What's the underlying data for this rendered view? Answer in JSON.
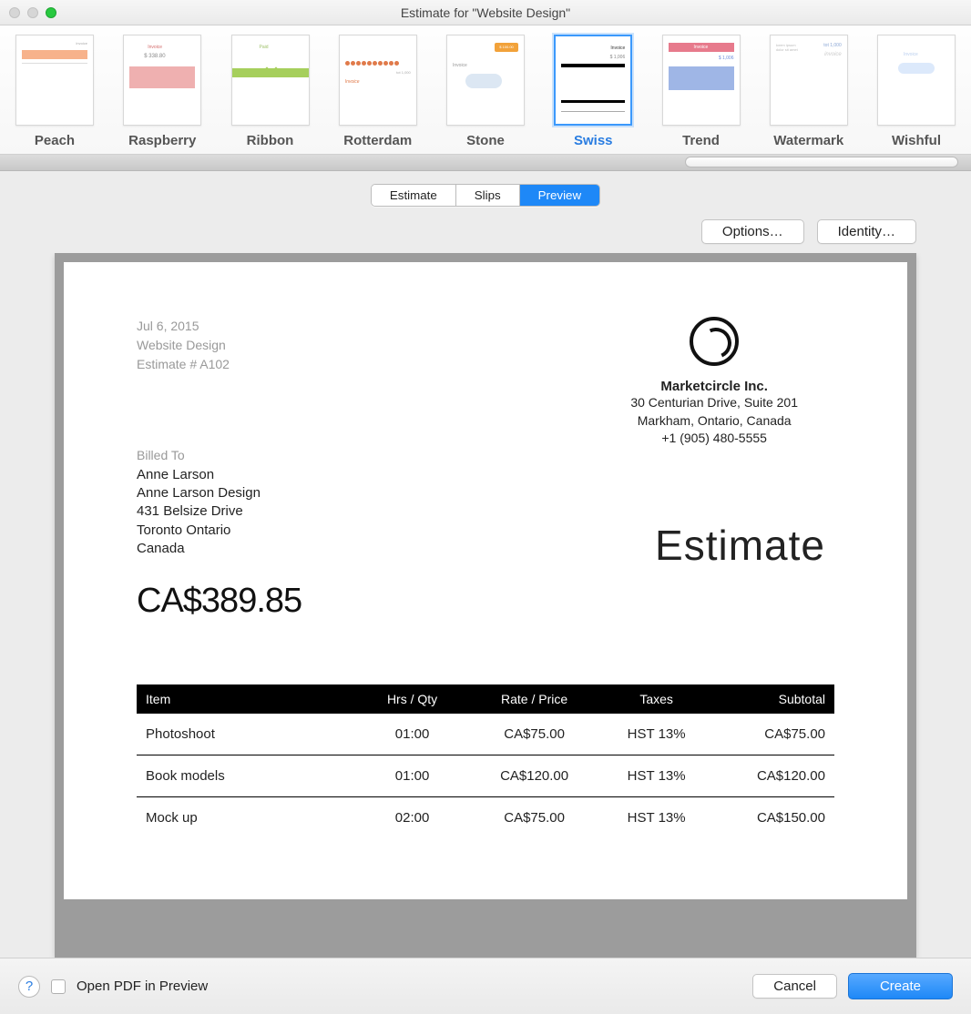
{
  "window": {
    "title": "Estimate for \"Website Design\""
  },
  "templates": [
    {
      "id": "peach",
      "label": "Peach"
    },
    {
      "id": "raspberry",
      "label": "Raspberry"
    },
    {
      "id": "ribbon",
      "label": "Ribbon"
    },
    {
      "id": "rotterdam",
      "label": "Rotterdam"
    },
    {
      "id": "stone",
      "label": "Stone"
    },
    {
      "id": "swiss",
      "label": "Swiss",
      "selected": true
    },
    {
      "id": "trend",
      "label": "Trend"
    },
    {
      "id": "watermark",
      "label": "Watermark"
    },
    {
      "id": "wishful",
      "label": "Wishful"
    }
  ],
  "tabs": {
    "estimate": "Estimate",
    "slips": "Slips",
    "preview": "Preview",
    "active": "preview"
  },
  "buttons": {
    "options": "Options…",
    "identity": "Identity…",
    "cancel": "Cancel",
    "create": "Create",
    "open_pdf": "Open PDF in Preview"
  },
  "preview": {
    "date": "Jul 6, 2015",
    "project": "Website Design",
    "estimate_no": "Estimate # A102",
    "company": {
      "name": "Marketcircle Inc.",
      "addr1": "30 Centurian Drive, Suite 201",
      "addr2": "Markham, Ontario, Canada",
      "phone": "+1 (905) 480-5555"
    },
    "billed_label": "Billed To",
    "billed_to": {
      "name": "Anne Larson",
      "company": "Anne Larson Design",
      "addr1": "431 Belsize Drive",
      "addr2": "Toronto Ontario",
      "country": "Canada"
    },
    "doc_title": "Estimate",
    "total": "CA$389.85",
    "columns": {
      "item": "Item",
      "qty": "Hrs / Qty",
      "rate": "Rate / Price",
      "taxes": "Taxes",
      "subtotal": "Subtotal"
    },
    "rows": [
      {
        "item": "Photoshoot",
        "qty": "01:00",
        "rate": "CA$75.00",
        "taxes": "HST 13%",
        "subtotal": "CA$75.00"
      },
      {
        "item": "Book models",
        "qty": "01:00",
        "rate": "CA$120.00",
        "taxes": "HST 13%",
        "subtotal": "CA$120.00"
      },
      {
        "item": "Mock up",
        "qty": "02:00",
        "rate": "CA$75.00",
        "taxes": "HST 13%",
        "subtotal": "CA$150.00"
      }
    ]
  }
}
